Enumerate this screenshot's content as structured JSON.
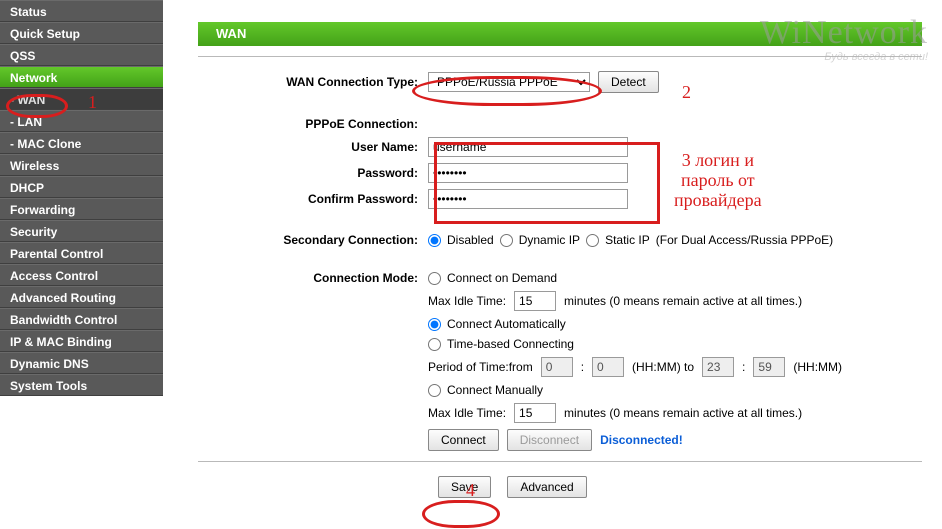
{
  "sidebar": {
    "items": [
      {
        "label": "Status"
      },
      {
        "label": "Quick Setup"
      },
      {
        "label": "QSS"
      },
      {
        "label": "Network"
      },
      {
        "label": "- WAN"
      },
      {
        "label": "- LAN"
      },
      {
        "label": "- MAC Clone"
      },
      {
        "label": "Wireless"
      },
      {
        "label": "DHCP"
      },
      {
        "label": "Forwarding"
      },
      {
        "label": "Security"
      },
      {
        "label": "Parental Control"
      },
      {
        "label": "Access Control"
      },
      {
        "label": "Advanced Routing"
      },
      {
        "label": "Bandwidth Control"
      },
      {
        "label": "IP & MAC Binding"
      },
      {
        "label": "Dynamic DNS"
      },
      {
        "label": "System Tools"
      }
    ]
  },
  "page": {
    "title": "WAN"
  },
  "form": {
    "conn_type_label": "WAN Connection Type:",
    "conn_type_value": "PPPoE/Russia PPPoE",
    "detect_btn": "Detect",
    "pppoe_section": "PPPoE Connection:",
    "username_label": "User Name:",
    "username_value": "username",
    "password_label": "Password:",
    "password_value": "********",
    "confirm_label": "Confirm Password:",
    "confirm_value": "********",
    "secondary_label": "Secondary Connection:",
    "secondary": {
      "disabled": "Disabled",
      "dynamic": "Dynamic IP",
      "static": "Static IP",
      "note": "(For Dual Access/Russia PPPoE)"
    },
    "connmode_label": "Connection Mode:",
    "mode": {
      "ondemand": "Connect on Demand",
      "idle_label": "Max Idle Time:",
      "idle_value": "15",
      "idle_unit": "minutes (0 means remain active at all times.)",
      "auto": "Connect Automatically",
      "timebased": "Time-based Connecting",
      "period_prefix": "Period of Time:from",
      "period_h1": "0",
      "period_m1": "0",
      "hhmm1": "(HH:MM) to",
      "period_h2": "23",
      "period_m2": "59",
      "hhmm2": "(HH:MM)",
      "manual": "Connect Manually",
      "idle2_value": "15"
    },
    "connect_btn": "Connect",
    "disconnect_btn": "Disconnect",
    "status_text": "Disconnected!",
    "save_btn": "Save",
    "advanced_btn": "Advanced"
  },
  "annotations": {
    "n1": "1",
    "n2": "2",
    "n3": "3 логин и\nпароль от\nпровайдера",
    "n4": "4"
  },
  "watermark": {
    "brand": "WiNetwork",
    "tagline": "Будь всегда в сети!"
  }
}
